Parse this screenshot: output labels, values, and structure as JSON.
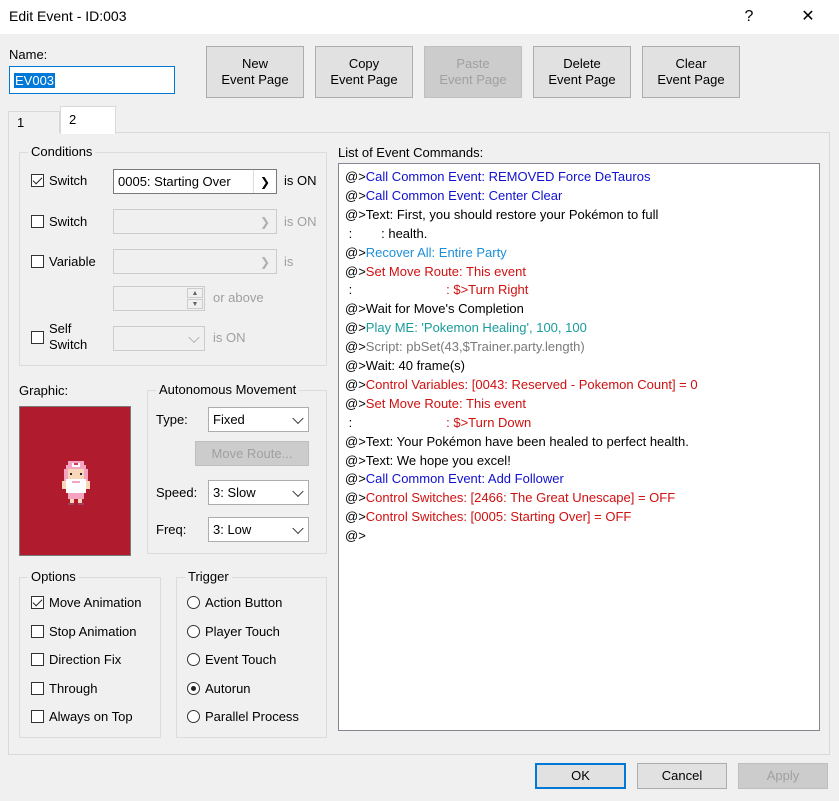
{
  "window": {
    "title": "Edit Event - ID:003",
    "help_label": "?",
    "close_label": "✕"
  },
  "name": {
    "label": "Name:",
    "value": "EV003"
  },
  "page_buttons": {
    "new_l1": "New",
    "new_l2": "Event Page",
    "copy_l1": "Copy",
    "copy_l2": "Event Page",
    "paste_l1": "Paste",
    "paste_l2": "Event Page",
    "delete_l1": "Delete",
    "delete_l2": "Event Page",
    "clear_l1": "Clear",
    "clear_l2": "Event Page"
  },
  "tabs": [
    {
      "label": "1",
      "active": false
    },
    {
      "label": "2",
      "active": true
    }
  ],
  "conditions": {
    "title": "Conditions",
    "switch1": {
      "label": "Switch",
      "checked": true,
      "value": "0005: Starting Over",
      "suffix": "is ON"
    },
    "switch2": {
      "label": "Switch",
      "checked": false,
      "value": "",
      "suffix": "is ON"
    },
    "variable": {
      "label": "Variable",
      "checked": false,
      "value": "",
      "suffix": "is"
    },
    "variable_min": {
      "value": "",
      "suffix": "or above"
    },
    "self_switch": {
      "label_l1": "Self",
      "label_l2": "Switch",
      "checked": false,
      "value": "",
      "suffix": "is ON"
    }
  },
  "graphic": {
    "label": "Graphic:"
  },
  "movement": {
    "title": "Autonomous Movement",
    "type_label": "Type:",
    "type_value": "Fixed",
    "move_route_button": "Move Route...",
    "speed_label": "Speed:",
    "speed_value": "3: Slow",
    "freq_label": "Freq:",
    "freq_value": "3: Low"
  },
  "options": {
    "title": "Options",
    "items": [
      {
        "label": "Move Animation",
        "checked": true
      },
      {
        "label": "Stop Animation",
        "checked": false
      },
      {
        "label": "Direction Fix",
        "checked": false
      },
      {
        "label": "Through",
        "checked": false
      },
      {
        "label": "Always on Top",
        "checked": false
      }
    ]
  },
  "trigger": {
    "title": "Trigger",
    "items": [
      {
        "label": "Action Button",
        "selected": false
      },
      {
        "label": "Player Touch",
        "selected": false
      },
      {
        "label": "Event Touch",
        "selected": false
      },
      {
        "label": "Autorun",
        "selected": true
      },
      {
        "label": "Parallel Process",
        "selected": false
      }
    ]
  },
  "commands": {
    "label": "List of Event Commands:",
    "lines": [
      {
        "prefix": "@>",
        "text": "Call Common Event: REMOVED Force DeTauros",
        "color": "blue"
      },
      {
        "prefix": "@>",
        "text": "Call Common Event: Center Clear",
        "color": "blue"
      },
      {
        "prefix": "@>",
        "text": "Text: First, you should restore your Pokémon to full",
        "color": "default"
      },
      {
        "prefix": " :        ",
        "text": ": health.",
        "color": "default"
      },
      {
        "prefix": "@>",
        "text": "Recover All: Entire Party",
        "color": "sky"
      },
      {
        "prefix": "@>",
        "text": "Set Move Route: This event",
        "color": "red"
      },
      {
        "prefix": " :                          ",
        "text": ": $>Turn Right",
        "color": "red"
      },
      {
        "prefix": "@>",
        "text": "Wait for Move's Completion",
        "color": "default"
      },
      {
        "prefix": "@>",
        "text": "Play ME: 'Pokemon Healing', 100, 100",
        "color": "teal"
      },
      {
        "prefix": "@>",
        "text": "Script: pbSet(43,$Trainer.party.length)",
        "color": "gray"
      },
      {
        "prefix": "@>",
        "text": "Wait: 40 frame(s)",
        "color": "default"
      },
      {
        "prefix": "@>",
        "text": "Control Variables: [0043: Reserved - Pokemon Count] = 0",
        "color": "red"
      },
      {
        "prefix": "@>",
        "text": "Set Move Route: This event",
        "color": "red"
      },
      {
        "prefix": " :                          ",
        "text": ": $>Turn Down",
        "color": "red"
      },
      {
        "prefix": "@>",
        "text": "Text: Your Pokémon have been healed to perfect health.",
        "color": "default"
      },
      {
        "prefix": "@>",
        "text": "Text: We hope you excel!",
        "color": "default"
      },
      {
        "prefix": "@>",
        "text": "Call Common Event: Add Follower",
        "color": "blue"
      },
      {
        "prefix": "@>",
        "text": "Control Switches: [2466: The Great Unescape] = OFF",
        "color": "red"
      },
      {
        "prefix": "@>",
        "text": "Control Switches: [0005: Starting Over] = OFF",
        "color": "red"
      },
      {
        "prefix": "@>",
        "text": "",
        "color": "default"
      }
    ]
  },
  "footer": {
    "ok": "OK",
    "cancel": "Cancel",
    "apply": "Apply"
  },
  "colors": {
    "graphic_bg": "#b01c2e",
    "accent": "#0078d7"
  }
}
